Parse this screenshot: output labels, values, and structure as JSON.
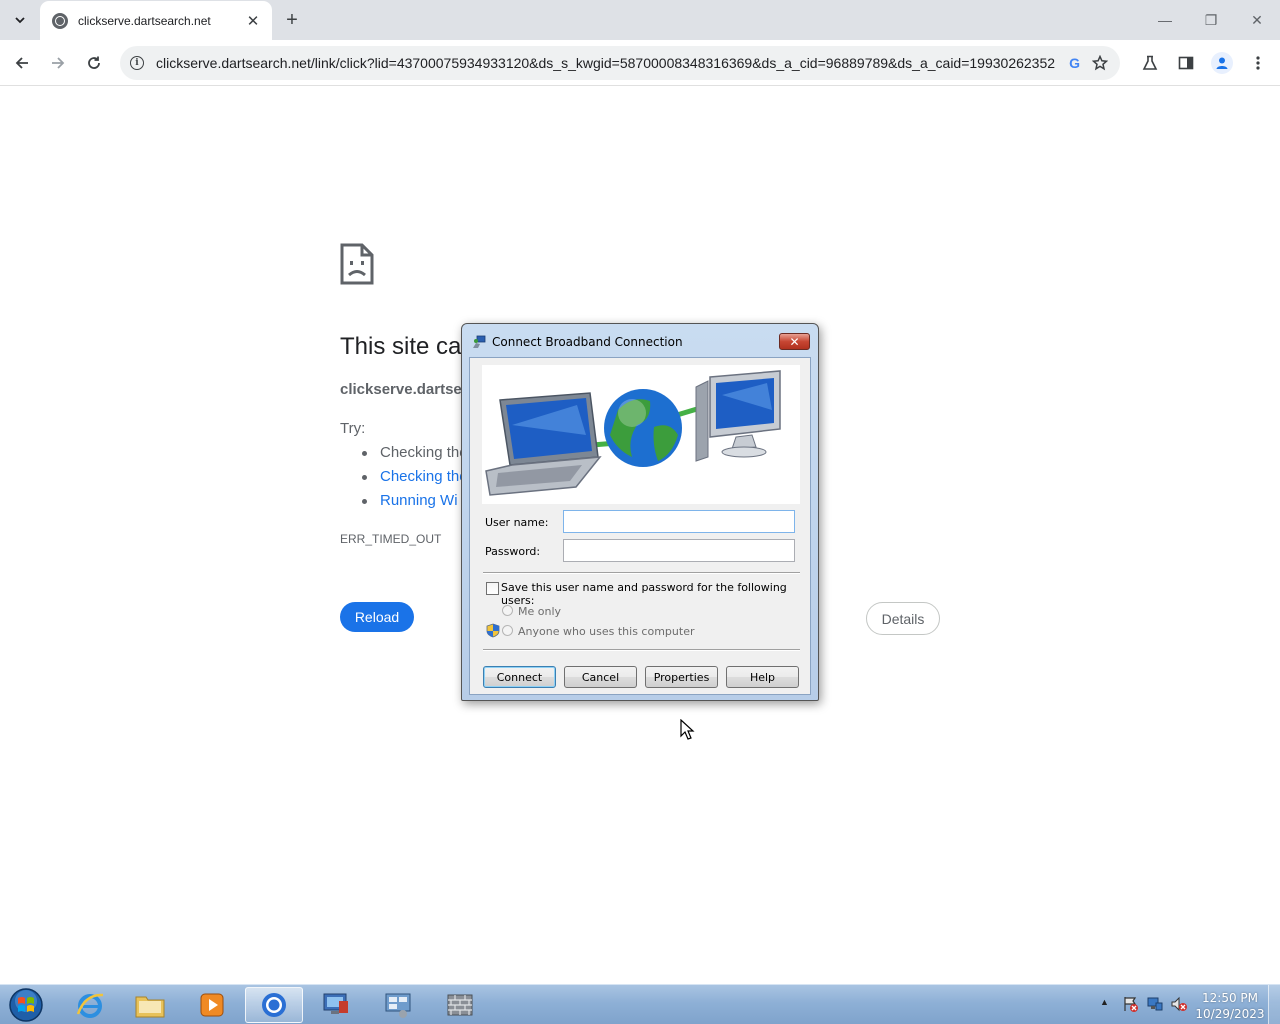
{
  "browser": {
    "tab_title": "clickserve.dartsearch.net",
    "tab_close": "✕",
    "new_tab": "+",
    "url": "clickserve.dartsearch.net/link/click?lid=43700075934933120&ds_s_kwgid=58700008348316369&ds_a_cid=96889789&ds_a_caid=19930262352...",
    "window_minimize": "—",
    "window_restore": "❐",
    "window_close": "✕"
  },
  "error_page": {
    "title": "This site ca",
    "host": "clickserve.dartsea",
    "try_label": "Try:",
    "suggestions": [
      "Checking the",
      "Checking the",
      "Running Wi"
    ],
    "error_code": "ERR_TIMED_OUT",
    "reload_label": "Reload",
    "details_label": "Details"
  },
  "dialog": {
    "title": "Connect Broadband Connection",
    "close": "✕",
    "username_label": "User name:",
    "username_value": "",
    "password_label": "Password:",
    "password_value": "",
    "save_checkbox_label": "Save this user name and password for the following users:",
    "radio_me_only": "Me only",
    "radio_anyone": "Anyone who uses this computer",
    "buttons": {
      "connect": "Connect",
      "cancel": "Cancel",
      "properties": "Properties",
      "help": "Help"
    }
  },
  "taskbar": {
    "clock_time": "12:50 PM",
    "clock_date": "10/29/2023",
    "tray_expand": "▲"
  },
  "colors": {
    "reload_button": "#1a73e8",
    "link": "#1a73e8",
    "taskbar": "#8eb0d6",
    "dialog_close": "#c74633"
  }
}
